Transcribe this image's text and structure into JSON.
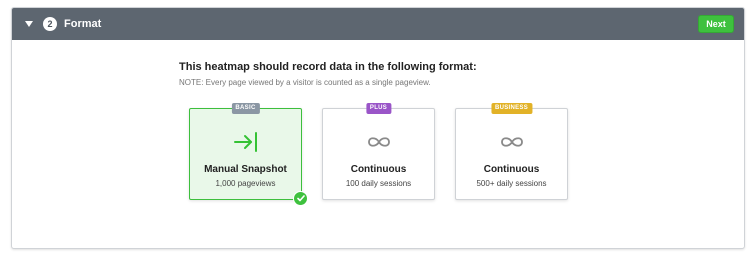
{
  "header": {
    "step_number": "2",
    "title": "Format",
    "next_label": "Next"
  },
  "main": {
    "heading": "This heatmap should record data in the following format:",
    "note": "NOTE: Every page viewed by a visitor is counted as a single pageview."
  },
  "options": [
    {
      "badge": "BASIC",
      "badge_color": "#8b97a4",
      "icon": "arrow-to-line-icon",
      "title": "Manual Snapshot",
      "subtitle": "1,000 pageviews",
      "selected": true
    },
    {
      "badge": "PLUS",
      "badge_color": "#9a55c8",
      "icon": "infinity-loop-icon",
      "title": "Continuous",
      "subtitle": "100 daily sessions",
      "selected": false
    },
    {
      "badge": "BUSINESS",
      "badge_color": "#e2b227",
      "icon": "infinity-loop-icon",
      "title": "Continuous",
      "subtitle": "500+ daily sessions",
      "selected": false
    }
  ],
  "colors": {
    "header_bg": "#5d6670",
    "accent_green": "#3ec13e",
    "selected_bg": "#e9f8e9"
  }
}
